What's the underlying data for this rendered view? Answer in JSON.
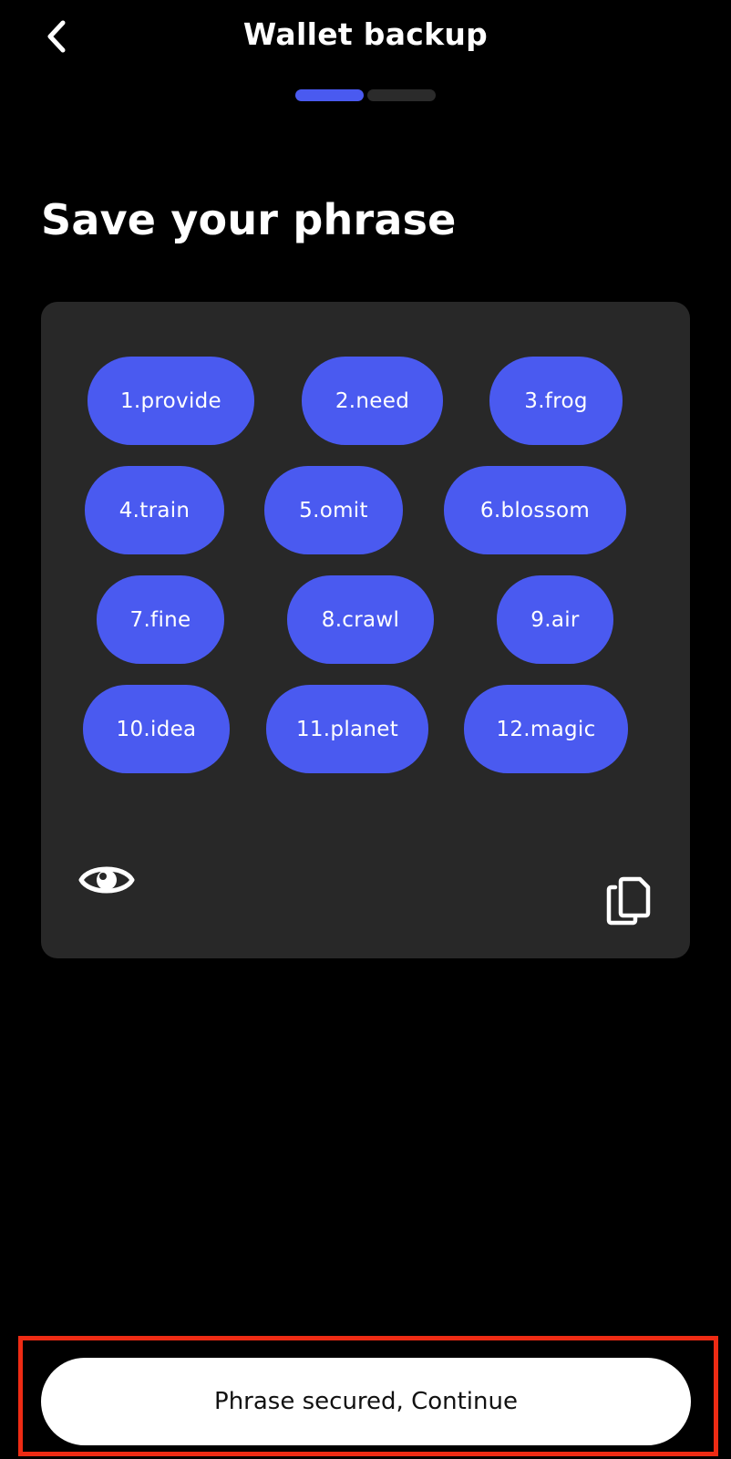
{
  "header": {
    "title": "Wallet backup",
    "back_icon": "chevron-left-icon"
  },
  "progress": {
    "current_step": 1,
    "total_steps": 2
  },
  "main": {
    "title": "Save your phrase"
  },
  "phrase": {
    "words": [
      {
        "label": "1.provide"
      },
      {
        "label": "2.need"
      },
      {
        "label": "3.frog"
      },
      {
        "label": "4.train"
      },
      {
        "label": "5.omit"
      },
      {
        "label": "6.blossom"
      },
      {
        "label": "7.fine"
      },
      {
        "label": "8.crawl"
      },
      {
        "label": "9.air"
      },
      {
        "label": "10.idea"
      },
      {
        "label": "11.planet"
      },
      {
        "label": "12.magic"
      }
    ],
    "reveal_icon": "eye-icon",
    "copy_icon": "copy-icon"
  },
  "footer": {
    "continue_label": "Phrase secured, Continue"
  },
  "colors": {
    "accent": "#4a5af0",
    "progress_inactive": "#2b2b2b",
    "card_bg": "#282828",
    "background": "#000000",
    "button_bg": "#ffffff",
    "highlight": "#ee2b14"
  }
}
